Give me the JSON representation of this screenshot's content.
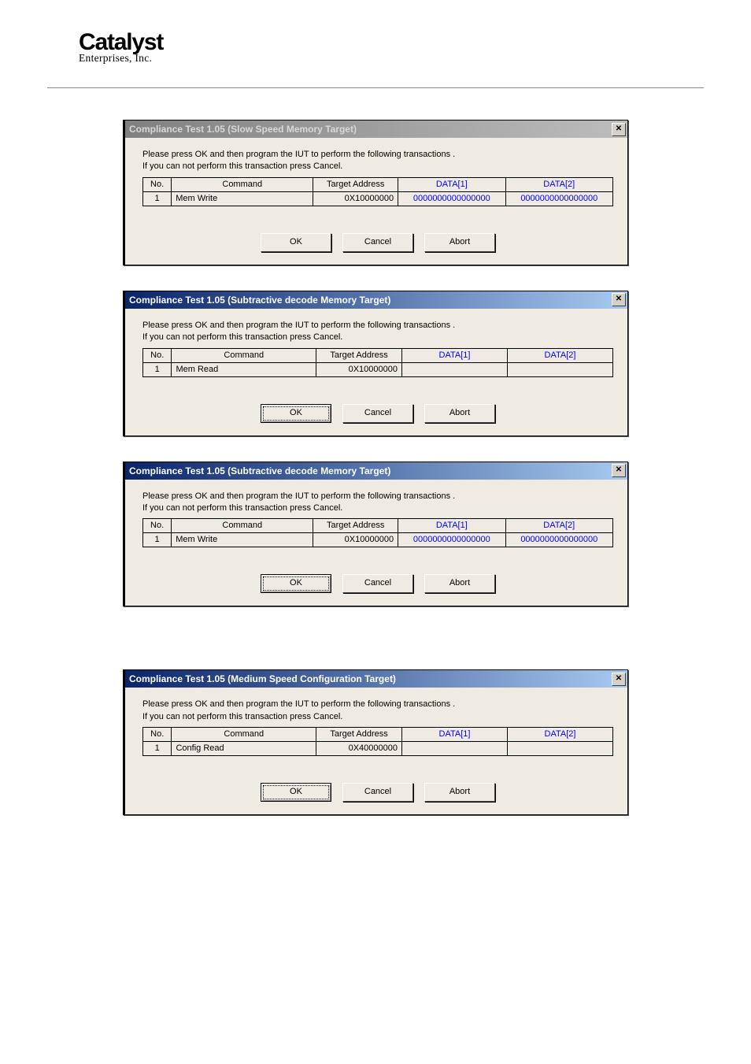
{
  "brand": {
    "name": "Catalyst",
    "sub": "Enterprises, Inc."
  },
  "common": {
    "instruction_line1": "Please press OK and then program the IUT to perform the following transactions .",
    "instruction_line2": "If you can not perform this transaction press Cancel.",
    "headers": {
      "no": "No.",
      "command": "Command",
      "target_address": "Target Address",
      "data1": "DATA[1]",
      "data2": "DATA[2]"
    },
    "buttons": {
      "ok": "OK",
      "cancel": "Cancel",
      "abort": "Abort",
      "close_x": "✕"
    }
  },
  "dialogs": [
    {
      "title": "Compliance Test 1.05 (Slow Speed Memory Target)",
      "active": false,
      "ok_default": false,
      "rows": [
        {
          "no": "1",
          "command": "Mem Write",
          "address": "0X10000000",
          "data1": "0000000000000000",
          "data2": "0000000000000000"
        }
      ]
    },
    {
      "title": "Compliance Test 1.05 (Subtractive decode Memory Target)",
      "active": true,
      "ok_default": true,
      "rows": [
        {
          "no": "1",
          "command": "Mem Read",
          "address": "0X10000000",
          "data1": "",
          "data2": ""
        }
      ]
    },
    {
      "title": "Compliance Test 1.05 (Subtractive decode Memory Target)",
      "active": true,
      "ok_default": true,
      "rows": [
        {
          "no": "1",
          "command": "Mem Write",
          "address": "0X10000000",
          "data1": "0000000000000000",
          "data2": "0000000000000000"
        }
      ]
    },
    {
      "title": "Compliance Test 1.05 (Medium Speed Configuration Target)",
      "active": true,
      "ok_default": true,
      "rows": [
        {
          "no": "1",
          "command": "Config Read",
          "address": "0X40000000",
          "data1": "",
          "data2": ""
        }
      ]
    }
  ]
}
